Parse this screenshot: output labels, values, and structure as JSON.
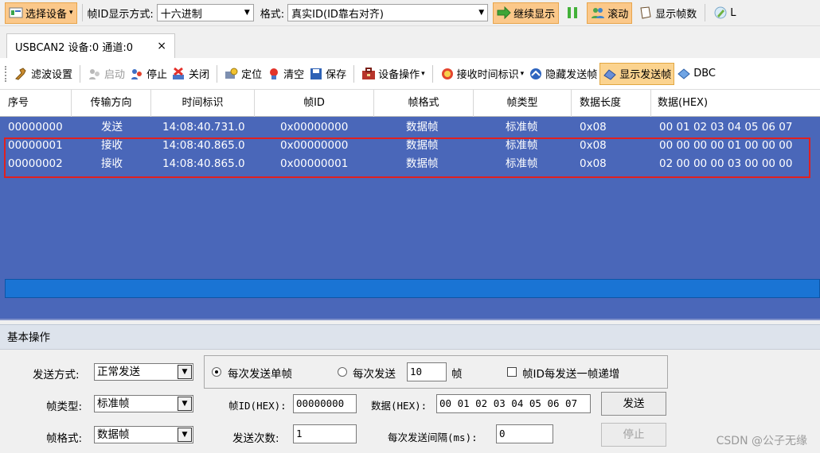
{
  "toolbar1": {
    "select_device": "选择设备",
    "frame_id_mode_label": "帧ID显示方式:",
    "frame_id_mode_value": "十六进制",
    "format_label": "格式:",
    "format_value": "真实ID(ID靠右对齐)",
    "continue_display": "继续显示",
    "scroll": "滚动",
    "show_frame_count": "显示帧数",
    "truncated_last": "L"
  },
  "tab": {
    "label": "USBCAN2 设备:0 通道:0",
    "close": "×"
  },
  "toolbar2": {
    "filter_settings": "滤波设置",
    "start": "启动",
    "stop": "停止",
    "close": "关闭",
    "locate": "定位",
    "clear": "清空",
    "save": "保存",
    "device_ops": "设备操作",
    "rx_time_mark": "接收时间标识",
    "hide_sent_frames": "隐藏发送帧",
    "show_sent_frames": "显示发送帧",
    "dbc": "DBC"
  },
  "grid": {
    "columns": [
      "序号",
      "传输方向",
      "时间标识",
      "帧ID",
      "帧格式",
      "帧类型",
      "数据长度",
      "数据(HEX)"
    ],
    "rows": [
      [
        "00000000",
        "发送",
        "14:08:40.731.0",
        "0x00000000",
        "数据帧",
        "标准帧",
        "0x08",
        "00 01 02 03 04 05 06 07"
      ],
      [
        "00000001",
        "接收",
        "14:08:40.865.0",
        "0x00000000",
        "数据帧",
        "标准帧",
        "0x08",
        "00 00 00 00 01 00 00 00"
      ],
      [
        "00000002",
        "接收",
        "14:08:40.865.0",
        "0x00000001",
        "数据帧",
        "标准帧",
        "0x08",
        "02 00 00 00 03 00 00 00"
      ]
    ]
  },
  "panel": {
    "title": "基本操作",
    "send_mode_label": "发送方式:",
    "send_mode_value": "正常发送",
    "radio_single_label": "每次发送单帧",
    "radio_multi_label": "每次发送",
    "multi_count": "10",
    "multi_unit": "帧",
    "increment_label": "帧ID每发送一帧递增",
    "frame_type_label": "帧类型:",
    "frame_type_value": "标准帧",
    "frame_id_label": "帧ID(HEX):",
    "frame_id_value": "00000000",
    "data_label": "数据(HEX):",
    "data_value": "00 01 02 03 04 05 06 07",
    "send_button": "发送",
    "frame_format_label": "帧格式:",
    "frame_format_value": "数据帧",
    "send_count_label": "发送次数:",
    "send_count_value": "1",
    "interval_label": "每次发送间隔(ms):",
    "interval_value": "0",
    "stop_button": "停止"
  },
  "watermark": "CSDN @公子无缘"
}
